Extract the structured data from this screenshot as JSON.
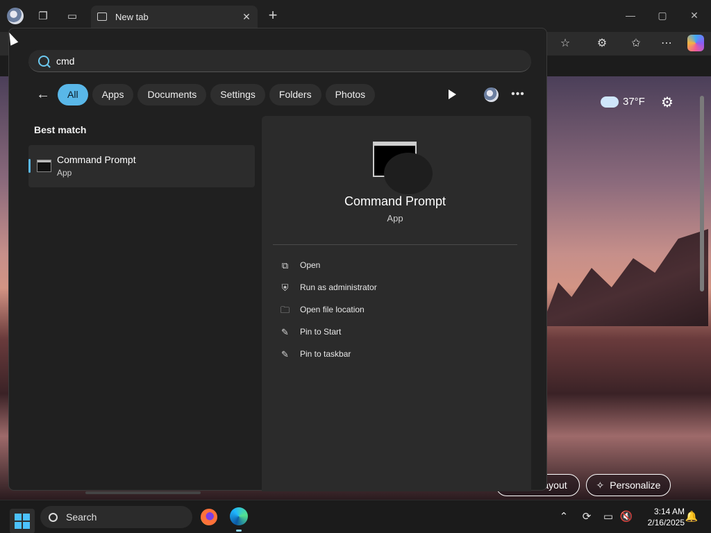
{
  "browser": {
    "tab_title": "New tab",
    "tab_close": "✕",
    "new_tab": "+",
    "minimize": "—",
    "maximize": "▢",
    "close": "✕"
  },
  "ntp": {
    "temperature": "37°F",
    "layout_label": "ayout",
    "personalize_label": "Personalize"
  },
  "search": {
    "query": "cmd",
    "chips": [
      "All",
      "Apps",
      "Documents",
      "Settings",
      "Folders",
      "Photos"
    ],
    "active_chip": "All",
    "best_match_heading": "Best match",
    "result": {
      "title": "Command Prompt",
      "subtitle": "App"
    },
    "detail": {
      "title": "Command Prompt",
      "subtitle": "App",
      "actions": [
        {
          "label": "Open",
          "icon": "open-external-icon"
        },
        {
          "label": "Run as administrator",
          "icon": "shield-icon"
        },
        {
          "label": "Open file location",
          "icon": "folder-icon"
        },
        {
          "label": "Pin to Start",
          "icon": "pin-icon"
        },
        {
          "label": "Pin to taskbar",
          "icon": "pin-icon"
        }
      ]
    }
  },
  "taskbar": {
    "search_label": "Search",
    "time": "3:14 AM",
    "date": "2/16/2025"
  },
  "colors": {
    "accent": "#59b7e8",
    "flyout_bg": "#202020",
    "detail_bg": "#2b2b2b"
  }
}
